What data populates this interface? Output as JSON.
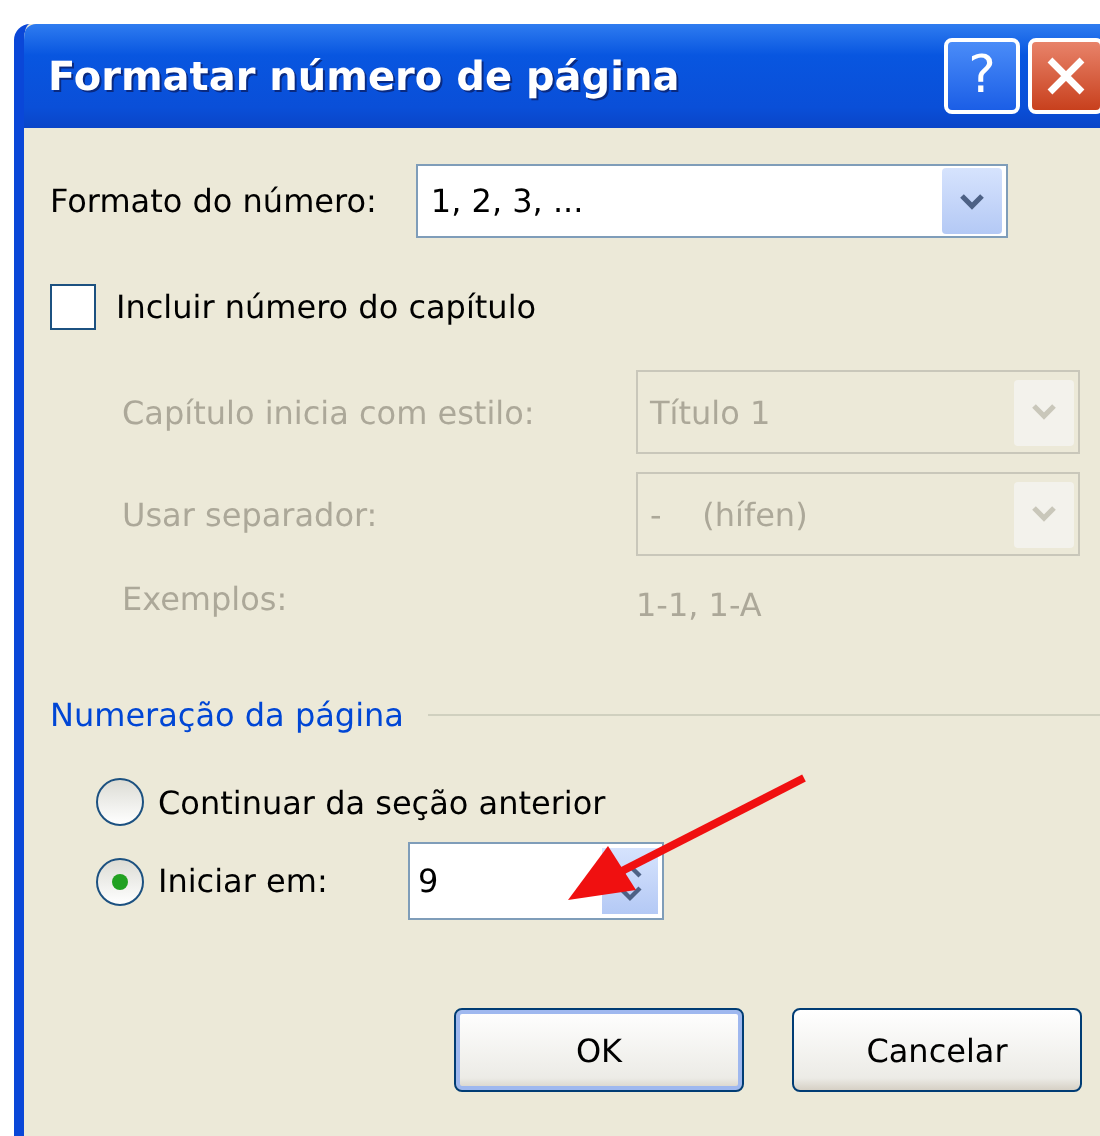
{
  "window": {
    "title": "Formatar número de página",
    "help_label": "?"
  },
  "number_format": {
    "label": "Formato do número:",
    "value": "1, 2, 3, ..."
  },
  "include_chapter": {
    "label": "Incluir número do capítulo",
    "checked": false
  },
  "chapter_options": {
    "disabled": true,
    "rows": [
      {
        "kind": "dropdown",
        "label": "Capítulo inicia com estilo:",
        "value": "Título 1"
      },
      {
        "kind": "dropdown",
        "label": "Usar separador:",
        "value": "-    (hífen)"
      },
      {
        "kind": "text",
        "label": "Exemplos:",
        "value": "1-1, 1-A"
      }
    ]
  },
  "page_numbering": {
    "title": "Numeração da página",
    "options": [
      {
        "kind": "radio",
        "label": "Continuar da seção anterior",
        "selected": false
      },
      {
        "kind": "spin",
        "label": "Iniciar em:",
        "selected": true,
        "value": "9"
      }
    ]
  },
  "buttons": [
    {
      "label": "OK",
      "default": true
    },
    {
      "label": "Cancelar",
      "default": false
    }
  ]
}
